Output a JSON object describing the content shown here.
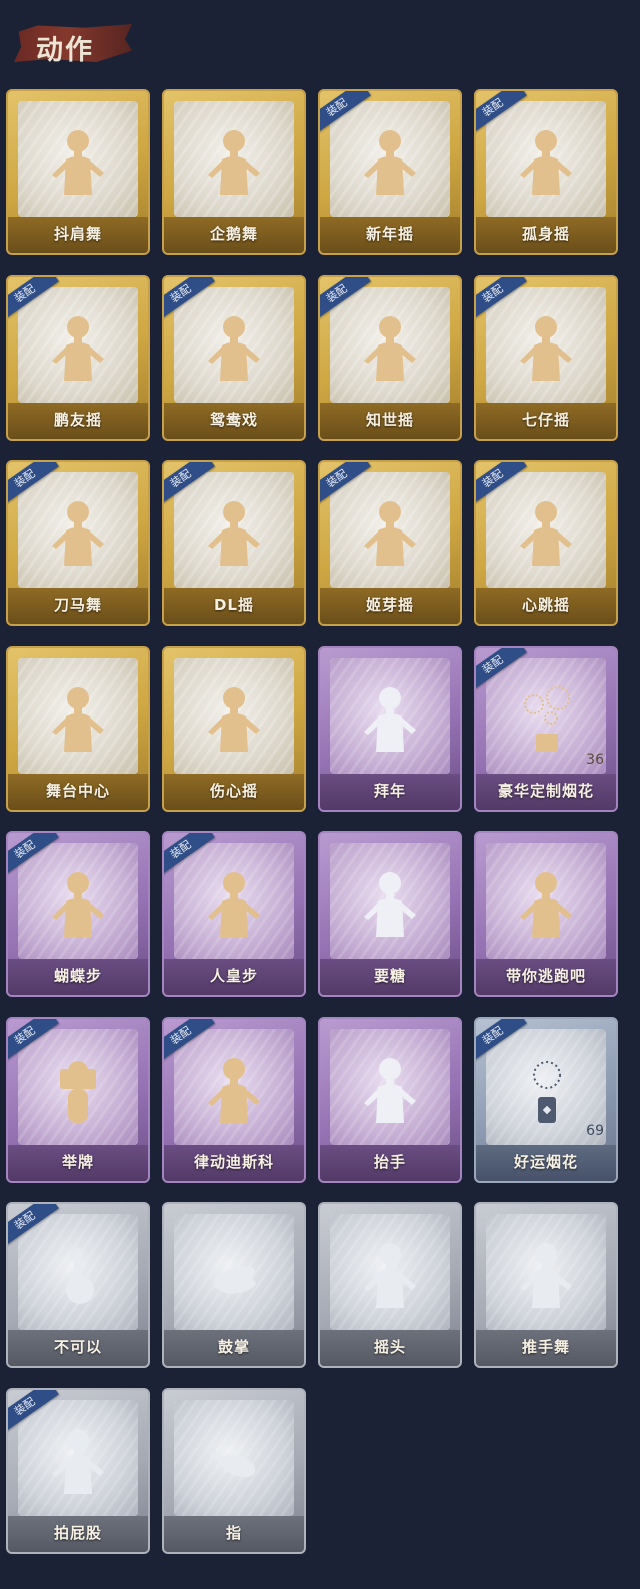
{
  "header": {
    "title": "动作"
  },
  "badge_text": "装配",
  "cards": [
    {
      "name": "抖肩舞",
      "tier": "gold",
      "equipped": false,
      "icon": "person-pose-icon"
    },
    {
      "name": "企鹅舞",
      "tier": "gold",
      "equipped": false,
      "icon": "person-pose-icon"
    },
    {
      "name": "新年摇",
      "tier": "gold",
      "equipped": true,
      "icon": "person-pose-icon"
    },
    {
      "name": "孤身摇",
      "tier": "gold",
      "equipped": true,
      "icon": "person-pose-icon"
    },
    {
      "name": "鹏友摇",
      "tier": "gold",
      "equipped": true,
      "icon": "person-pose-icon"
    },
    {
      "name": "鸳鸯戏",
      "tier": "gold",
      "equipped": true,
      "icon": "person-pose-icon"
    },
    {
      "name": "知世摇",
      "tier": "gold",
      "equipped": true,
      "icon": "person-pose-icon"
    },
    {
      "name": "七仔摇",
      "tier": "gold",
      "equipped": true,
      "icon": "person-pose-icon"
    },
    {
      "name": "刀马舞",
      "tier": "gold",
      "equipped": true,
      "icon": "person-pose-icon"
    },
    {
      "name": "DL摇",
      "tier": "gold",
      "equipped": true,
      "icon": "person-pose-icon"
    },
    {
      "name": "姬芽摇",
      "tier": "gold",
      "equipped": true,
      "icon": "person-pose-icon"
    },
    {
      "name": "心跳摇",
      "tier": "gold",
      "equipped": true,
      "icon": "person-pose-icon"
    },
    {
      "name": "舞台中心",
      "tier": "gold",
      "equipped": false,
      "icon": "person-pose-icon"
    },
    {
      "name": "伤心摇",
      "tier": "gold",
      "equipped": false,
      "icon": "person-pose-icon"
    },
    {
      "name": "拜年",
      "tier": "purple",
      "equipped": false,
      "icon": "person-pose-icon"
    },
    {
      "name": "豪华定制烟花",
      "tier": "purple",
      "equipped": true,
      "icon": "firework-box-icon",
      "count": "36"
    },
    {
      "name": "蝴蝶步",
      "tier": "purple",
      "equipped": true,
      "icon": "person-pose-icon"
    },
    {
      "name": "人皇步",
      "tier": "purple",
      "equipped": true,
      "icon": "person-pose-icon"
    },
    {
      "name": "要糖",
      "tier": "purple",
      "equipped": false,
      "icon": "person-pose-icon"
    },
    {
      "name": "带你逃跑吧",
      "tier": "purple",
      "equipped": false,
      "icon": "person-pose-icon"
    },
    {
      "name": "举牌",
      "tier": "purple",
      "equipped": true,
      "icon": "person-sign-icon"
    },
    {
      "name": "律动迪斯科",
      "tier": "purple",
      "equipped": true,
      "icon": "person-pose-icon"
    },
    {
      "name": "抬手",
      "tier": "purple",
      "equipped": false,
      "icon": "person-pose-icon"
    },
    {
      "name": "好运烟花",
      "tier": "bluegray",
      "equipped": true,
      "icon": "firework-can-icon",
      "count": "69"
    },
    {
      "name": "不可以",
      "tier": "gray",
      "equipped": true,
      "icon": "finger-icon"
    },
    {
      "name": "鼓掌",
      "tier": "gray",
      "equipped": false,
      "icon": "clap-hands-icon"
    },
    {
      "name": "摇头",
      "tier": "gray",
      "equipped": false,
      "icon": "person-pose-icon"
    },
    {
      "name": "推手舞",
      "tier": "gray",
      "equipped": false,
      "icon": "person-pose-icon"
    },
    {
      "name": "拍屁股",
      "tier": "gray",
      "equipped": true,
      "icon": "person-pose-icon"
    },
    {
      "name": "指",
      "tier": "gray",
      "equipped": false,
      "icon": "pointing-hand-icon"
    }
  ]
}
